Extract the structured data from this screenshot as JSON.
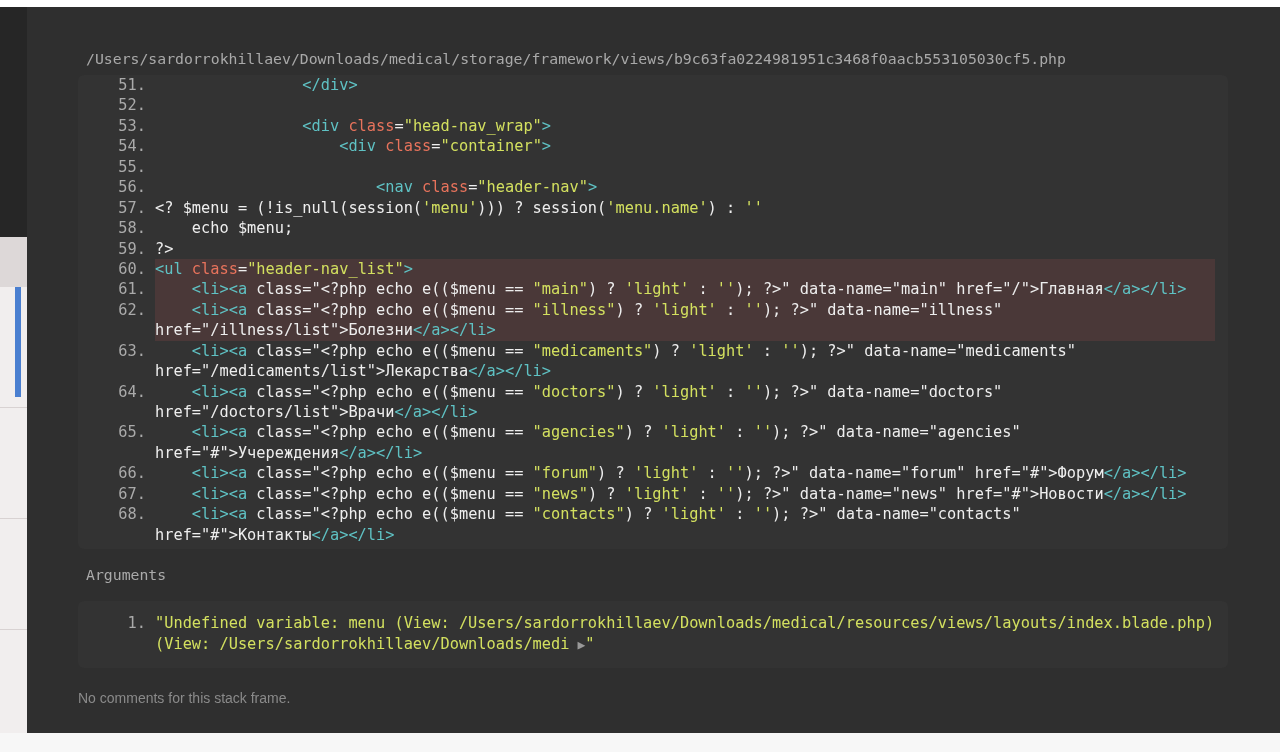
{
  "frame": {
    "file_path": "/Users/sardorrokhillaev/Downloads/medical/storage/framework/views/b9c63fa0224981951c3468f0aacb553105030cf5.php",
    "code_lines": [
      {
        "number": "51.",
        "highlighted": false,
        "rows": [
          {
            "tokens": [
              {
                "kind": "tag",
                "text": "                </div>"
              }
            ]
          }
        ]
      },
      {
        "number": "52.",
        "highlighted": false
      },
      {
        "number": "53.",
        "highlighted": false,
        "rows": [
          {
            "tokens": [
              {
                "kind": "tag",
                "text": "                <div "
              },
              {
                "kind": "attr",
                "text": "class"
              },
              {
                "kind": "plain",
                "text": "="
              },
              {
                "kind": "str",
                "text": "\"head-nav_wrap\""
              },
              {
                "kind": "tag",
                "text": ">"
              }
            ]
          }
        ]
      },
      {
        "number": "54.",
        "highlighted": false,
        "rows": [
          {
            "tokens": [
              {
                "kind": "tag",
                "text": "                    <div "
              },
              {
                "kind": "attr",
                "text": "class"
              },
              {
                "kind": "plain",
                "text": "="
              },
              {
                "kind": "str",
                "text": "\"container\""
              },
              {
                "kind": "tag",
                "text": ">"
              }
            ]
          }
        ]
      },
      {
        "number": "55.",
        "highlighted": false
      },
      {
        "number": "56.",
        "highlighted": false,
        "rows": [
          {
            "tokens": [
              {
                "kind": "tag",
                "text": "                        <nav "
              },
              {
                "kind": "attr",
                "text": "class"
              },
              {
                "kind": "plain",
                "text": "="
              },
              {
                "kind": "str",
                "text": "\"header-nav\""
              },
              {
                "kind": "tag",
                "text": ">"
              }
            ]
          }
        ]
      },
      {
        "number": "57.",
        "highlighted": false,
        "rows": [
          {
            "tokens": [
              {
                "kind": "plain",
                "text": "<? $menu = (!is_null(session("
              },
              {
                "kind": "str",
                "text": "'menu'"
              },
              {
                "kind": "plain",
                "text": "))) ? session("
              },
              {
                "kind": "str",
                "text": "'menu.name'"
              },
              {
                "kind": "plain",
                "text": ") : "
              },
              {
                "kind": "str",
                "text": "''"
              }
            ]
          }
        ]
      },
      {
        "number": "58.",
        "highlighted": false,
        "rows": [
          {
            "tokens": [
              {
                "kind": "plain",
                "text": "    echo $menu;"
              }
            ]
          }
        ]
      },
      {
        "number": "59.",
        "highlighted": false,
        "rows": [
          {
            "tokens": [
              {
                "kind": "plain",
                "text": "?>"
              }
            ]
          }
        ]
      },
      {
        "number": "60.",
        "highlighted": true,
        "rows": [
          {
            "tokens": [
              {
                "kind": "tag",
                "text": "<ul "
              },
              {
                "kind": "attr",
                "text": "class"
              },
              {
                "kind": "plain",
                "text": "="
              },
              {
                "kind": "str",
                "text": "\"header-nav_list\""
              },
              {
                "kind": "tag",
                "text": ">"
              }
            ]
          }
        ]
      },
      {
        "number": "61.",
        "highlighted": true,
        "rows": [
          {
            "tokens": [
              {
                "kind": "tag",
                "text": "    <li><a"
              },
              {
                "kind": "plain",
                "text": " class=\"<?php echo e(($menu == "
              },
              {
                "kind": "str",
                "text": "\"main\""
              },
              {
                "kind": "plain",
                "text": ") ? "
              },
              {
                "kind": "str",
                "text": "'light'"
              },
              {
                "kind": "plain",
                "text": " : "
              },
              {
                "kind": "str",
                "text": "''"
              },
              {
                "kind": "plain",
                "text": "); ?>\" data-name=\"main\" href=\"/\">Главная"
              },
              {
                "kind": "tag",
                "text": "</a></li>"
              }
            ]
          }
        ]
      },
      {
        "number": "62.",
        "highlighted": true,
        "rows": [
          {
            "tokens": [
              {
                "kind": "tag",
                "text": "    <li><a"
              },
              {
                "kind": "plain",
                "text": " class=\"<?php echo e(($menu == "
              },
              {
                "kind": "str",
                "text": "\"illness\""
              },
              {
                "kind": "plain",
                "text": ") ? "
              },
              {
                "kind": "str",
                "text": "'light'"
              },
              {
                "kind": "plain",
                "text": " : "
              },
              {
                "kind": "str",
                "text": "''"
              },
              {
                "kind": "plain",
                "text": "); ?>\" data-name=\"illness\""
              }
            ]
          },
          {
            "tokens": [
              {
                "kind": "plain",
                "text": "href=\"/illness/list\">Болезни"
              },
              {
                "kind": "tag",
                "text": "</a></li>"
              }
            ]
          }
        ]
      },
      {
        "number": "63.",
        "highlighted": false,
        "rows": [
          {
            "tokens": [
              {
                "kind": "tag",
                "text": "    <li><a"
              },
              {
                "kind": "plain",
                "text": " class=\"<?php echo e(($menu == "
              },
              {
                "kind": "str",
                "text": "\"medicaments\""
              },
              {
                "kind": "plain",
                "text": ") ? "
              },
              {
                "kind": "str",
                "text": "'light'"
              },
              {
                "kind": "plain",
                "text": " : "
              },
              {
                "kind": "str",
                "text": "''"
              },
              {
                "kind": "plain",
                "text": "); ?>\" data-name=\"medicaments\""
              }
            ]
          },
          {
            "tokens": [
              {
                "kind": "plain",
                "text": "href=\"/medicaments/list\">Лекарства"
              },
              {
                "kind": "tag",
                "text": "</a></li>"
              }
            ]
          }
        ]
      },
      {
        "number": "64.",
        "highlighted": false,
        "rows": [
          {
            "tokens": [
              {
                "kind": "tag",
                "text": "    <li><a"
              },
              {
                "kind": "plain",
                "text": " class=\"<?php echo e(($menu == "
              },
              {
                "kind": "str",
                "text": "\"doctors\""
              },
              {
                "kind": "plain",
                "text": ") ? "
              },
              {
                "kind": "str",
                "text": "'light'"
              },
              {
                "kind": "plain",
                "text": " : "
              },
              {
                "kind": "str",
                "text": "''"
              },
              {
                "kind": "plain",
                "text": "); ?>\" data-name=\"doctors\""
              }
            ]
          },
          {
            "tokens": [
              {
                "kind": "plain",
                "text": "href=\"/doctors/list\">Врачи"
              },
              {
                "kind": "tag",
                "text": "</a></li>"
              }
            ]
          }
        ]
      },
      {
        "number": "65.",
        "highlighted": false,
        "rows": [
          {
            "tokens": [
              {
                "kind": "tag",
                "text": "    <li><a"
              },
              {
                "kind": "plain",
                "text": " class=\"<?php echo e(($menu == "
              },
              {
                "kind": "str",
                "text": "\"agencies\""
              },
              {
                "kind": "plain",
                "text": ") ? "
              },
              {
                "kind": "str",
                "text": "'light'"
              },
              {
                "kind": "plain",
                "text": " : "
              },
              {
                "kind": "str",
                "text": "''"
              },
              {
                "kind": "plain",
                "text": "); ?>\" data-name=\"agencies\""
              }
            ]
          },
          {
            "tokens": [
              {
                "kind": "plain",
                "text": "href=\"#\">Учереждения"
              },
              {
                "kind": "tag",
                "text": "</a></li>"
              }
            ]
          }
        ]
      },
      {
        "number": "66.",
        "highlighted": false,
        "rows": [
          {
            "tokens": [
              {
                "kind": "tag",
                "text": "    <li><a"
              },
              {
                "kind": "plain",
                "text": " class=\"<?php echo e(($menu == "
              },
              {
                "kind": "str",
                "text": "\"forum\""
              },
              {
                "kind": "plain",
                "text": ") ? "
              },
              {
                "kind": "str",
                "text": "'light'"
              },
              {
                "kind": "plain",
                "text": " : "
              },
              {
                "kind": "str",
                "text": "''"
              },
              {
                "kind": "plain",
                "text": "); ?>\" data-name=\"forum\" href=\"#\">Форум"
              },
              {
                "kind": "tag",
                "text": "</a></li>"
              }
            ]
          }
        ]
      },
      {
        "number": "67.",
        "highlighted": false,
        "rows": [
          {
            "tokens": [
              {
                "kind": "tag",
                "text": "    <li><a"
              },
              {
                "kind": "plain",
                "text": " class=\"<?php echo e(($menu == "
              },
              {
                "kind": "str",
                "text": "\"news\""
              },
              {
                "kind": "plain",
                "text": ") ? "
              },
              {
                "kind": "str",
                "text": "'light'"
              },
              {
                "kind": "plain",
                "text": " : "
              },
              {
                "kind": "str",
                "text": "''"
              },
              {
                "kind": "plain",
                "text": "); ?>\" data-name=\"news\" href=\"#\">Новости"
              },
              {
                "kind": "tag",
                "text": "</a></li>"
              }
            ]
          }
        ]
      },
      {
        "number": "68.",
        "highlighted": false,
        "rows": [
          {
            "tokens": [
              {
                "kind": "tag",
                "text": "    <li><a"
              },
              {
                "kind": "plain",
                "text": " class=\"<?php echo e(($menu == "
              },
              {
                "kind": "str",
                "text": "\"contacts\""
              },
              {
                "kind": "plain",
                "text": ") ? "
              },
              {
                "kind": "str",
                "text": "'light'"
              },
              {
                "kind": "plain",
                "text": " : "
              },
              {
                "kind": "str",
                "text": "''"
              },
              {
                "kind": "plain",
                "text": "); ?>\" data-name=\"contacts\""
              }
            ]
          },
          {
            "tokens": [
              {
                "kind": "plain",
                "text": "href=\"#\">Контакты"
              },
              {
                "kind": "tag",
                "text": "</a></li>"
              }
            ]
          }
        ]
      }
    ],
    "arguments_label": "Arguments",
    "arguments": [
      {
        "number": "1.",
        "rows": [
          "\"Undefined variable: menu (View: /Users/sardorrokhillaev/Downloads/medical/resources/views/layouts/index.blade.php)",
          "(View: /Users/sardorrokhillaev/Downloads/medi"
        ],
        "expand_glyph": "▶",
        "closing": "\""
      }
    ],
    "comments": "No comments for this stack frame."
  }
}
